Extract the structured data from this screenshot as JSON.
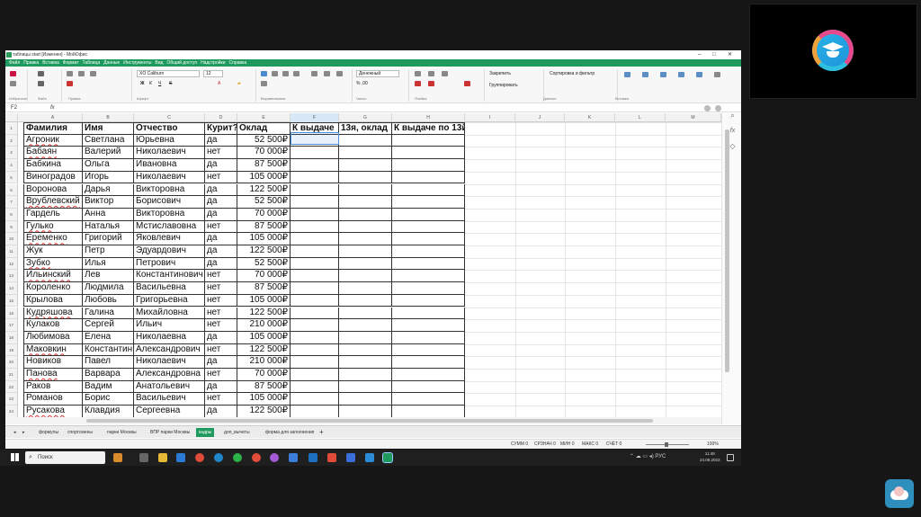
{
  "window": {
    "title": "таблицы start [Изменен] - МойОфис",
    "menu": [
      "Файл",
      "Правка",
      "Вставка",
      "Формат",
      "Таблица",
      "Данные",
      "Инструменты",
      "Вид",
      "Общий доступ",
      "Надстройки",
      "Справка"
    ]
  },
  "ribbon": {
    "groups": [
      "Избранное",
      "Файл",
      "Правка",
      "Шрифт",
      "Выравнивание",
      "Число",
      "Ячейка",
      "Данные",
      "Вставка"
    ],
    "font_name": "XO Caliburn",
    "font_size": "12",
    "number_format": "Денежный",
    "freeze_label": "Закрепить",
    "group_label": "Группировать",
    "sort_label": "Сортировка и фильтр"
  },
  "formula_bar": {
    "cell_ref": "F2",
    "fx": "fx",
    "value": ""
  },
  "columns": [
    "A",
    "B",
    "C",
    "D",
    "E",
    "F",
    "G",
    "H",
    "I",
    "J",
    "K",
    "L",
    "M"
  ],
  "table": {
    "headers": [
      "Фамилия",
      "Имя",
      "Отчество",
      "Курит?",
      "Оклад",
      "К выдаче",
      "13я, оклад",
      "К выдаче по 13й"
    ],
    "rows": [
      [
        "Агроник",
        "Светлана",
        "Юрьевна",
        "да",
        "52 500₽"
      ],
      [
        "Бабаян",
        "Валерий",
        "Николаевич",
        "нет",
        "70 000₽"
      ],
      [
        "Бабкина",
        "Ольга",
        "Ивановна",
        "да",
        "87 500₽"
      ],
      [
        "Виноградов",
        "Игорь",
        "Николаевич",
        "нет",
        "105 000₽"
      ],
      [
        "Воронова",
        "Дарья",
        "Викторовна",
        "да",
        "122 500₽"
      ],
      [
        "Врублевский",
        "Виктор",
        "Борисович",
        "да",
        "52 500₽"
      ],
      [
        "Гардель",
        "Анна",
        "Викторовна",
        "да",
        "70 000₽"
      ],
      [
        "Гулько",
        "Наталья",
        "Мстиславовна",
        "нет",
        "87 500₽"
      ],
      [
        "Еременко",
        "Григорий",
        "Яковлевич",
        "да",
        "105 000₽"
      ],
      [
        "Жук",
        "Петр",
        "Эдуардович",
        "да",
        "122 500₽"
      ],
      [
        "Зубко",
        "Илья",
        "Петрович",
        "да",
        "52 500₽"
      ],
      [
        "Ильинский",
        "Лев",
        "Константинович",
        "нет",
        "70 000₽"
      ],
      [
        "Короленко",
        "Людмила",
        "Васильевна",
        "нет",
        "87 500₽"
      ],
      [
        "Крылова",
        "Любовь",
        "Григорьевна",
        "нет",
        "105 000₽"
      ],
      [
        "Кудряшова",
        "Галина",
        "Михайловна",
        "нет",
        "122 500₽"
      ],
      [
        "Кулаков",
        "Сергей",
        "Ильич",
        "нет",
        "210 000₽"
      ],
      [
        "Любимова",
        "Елена",
        "Николаевна",
        "да",
        "105 000₽"
      ],
      [
        "Маковкин",
        "Константин",
        "Александрович",
        "нет",
        "122 500₽"
      ],
      [
        "Новиков",
        "Павел",
        "Николаевич",
        "да",
        "210 000₽"
      ],
      [
        "Панова",
        "Варвара",
        "Александровна",
        "нет",
        "70 000₽"
      ],
      [
        "Раков",
        "Вадим",
        "Анатольевич",
        "да",
        "87 500₽"
      ],
      [
        "Романов",
        "Борис",
        "Васильевич",
        "нет",
        "105 000₽"
      ],
      [
        "Русакова",
        "Клавдия",
        "Сергеевна",
        "да",
        "122 500₽"
      ]
    ],
    "spellcheck_rows": [
      0,
      1,
      5,
      7,
      8,
      10,
      11,
      14,
      17,
      19,
      22
    ]
  },
  "sheet_tabs": [
    "формулы",
    "спортсмены",
    "парки Москвы",
    "ВПР парки Москвы",
    "кадры",
    "доп_вычеты",
    "форма для заполнения"
  ],
  "active_tab": "кадры",
  "status": {
    "sum": "СУММ 0",
    "avg": "СРЗНАЧ 0",
    "min": "МИН 0",
    "max": "МАКС 0",
    "count": "СЧЁТ 0",
    "zoom": "100%"
  },
  "taskbar": {
    "search_placeholder": "Поиск",
    "lang": "РУС",
    "time": "11:48",
    "date": "24.08.2023"
  }
}
